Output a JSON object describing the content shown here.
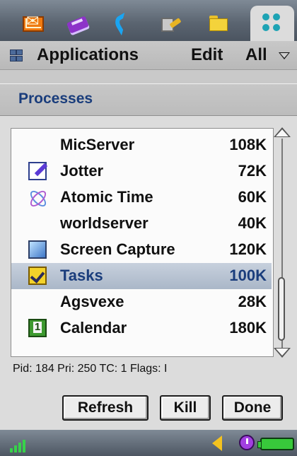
{
  "tabs": [
    {
      "icon": "envelope-icon"
    },
    {
      "icon": "book-icon"
    },
    {
      "icon": "phone-icon"
    },
    {
      "icon": "tools-icon"
    },
    {
      "icon": "folder-icon"
    },
    {
      "icon": "applications-grid-icon",
      "active": true
    }
  ],
  "menubar": {
    "icon": "menu-icon",
    "applications": "Applications",
    "edit": "Edit",
    "all": "All",
    "all_icon": "chevron-down-icon"
  },
  "dialog": {
    "title": "Processes",
    "processes": [
      {
        "name": "MicServer",
        "size": "108K",
        "icon": ""
      },
      {
        "name": "Jotter",
        "size": "72K",
        "icon": "jotter-icon"
      },
      {
        "name": "Atomic Time",
        "size": "60K",
        "icon": "atomic-time-icon"
      },
      {
        "name": "worldserver",
        "size": "40K",
        "icon": ""
      },
      {
        "name": "Screen Capture",
        "size": "120K",
        "icon": "screen-capture-icon"
      },
      {
        "name": "Tasks",
        "size": "100K",
        "icon": "tasks-icon",
        "selected": true
      },
      {
        "name": "Agsvexe",
        "size": "28K",
        "icon": ""
      },
      {
        "name": "Calendar",
        "size": "180K",
        "icon": "calendar-icon"
      }
    ],
    "info": "Pid: 184 Pri: 250 TC: 1 Flags: I",
    "buttons": {
      "refresh": "Refresh",
      "kill": "Kill",
      "done": "Done"
    }
  },
  "statusbar": {
    "signal_icon": "signal-strength-icon",
    "volume_icon": "speaker-icon",
    "clock_icon": "clock-icon",
    "battery_icon": "battery-icon"
  },
  "colors": {
    "title_text": "#1a3d7c",
    "selection": "#aab7c8",
    "battery": "#38c93b"
  }
}
